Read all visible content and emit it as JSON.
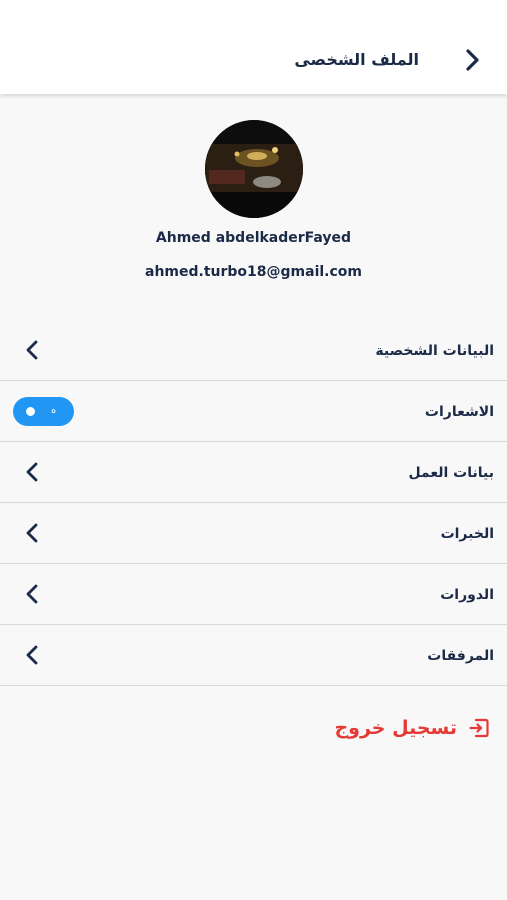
{
  "header": {
    "title": "الملف الشخصى",
    "back_icon": "chevron-right-icon"
  },
  "profile": {
    "name": "Ahmed abdelkaderFayed",
    "email": "ahmed.turbo18@gmail.com"
  },
  "menu": {
    "items": [
      {
        "label": "البيانات الشخصية",
        "control": "chevron-left-icon"
      },
      {
        "label": "الاشعارات",
        "control": "toggle",
        "toggle_state": "on",
        "toggle_text": "ه"
      },
      {
        "label": "بيانات العمل",
        "control": "chevron-left-icon"
      },
      {
        "label": "الخبرات",
        "control": "chevron-left-icon"
      },
      {
        "label": "الدورات",
        "control": "chevron-left-icon"
      },
      {
        "label": "المرفقات",
        "control": "chevron-left-icon"
      }
    ]
  },
  "logout": {
    "label": "تسجيل خروج",
    "icon": "logout-icon",
    "color": "#e53935"
  },
  "colors": {
    "text_primary": "#1b2a46",
    "accent": "#2196f3",
    "background": "#f8f8f8",
    "danger": "#e53935"
  }
}
